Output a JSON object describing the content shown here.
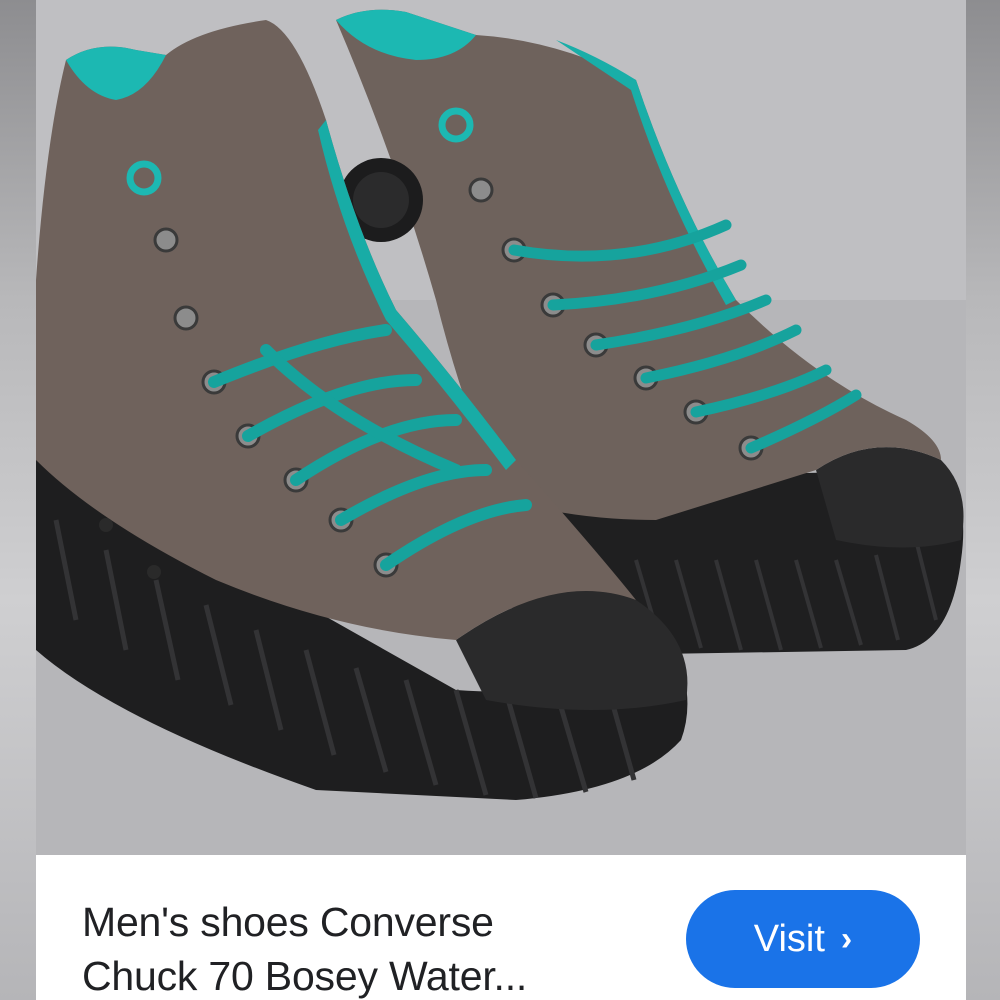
{
  "product": {
    "title_line1": "Men's shoes Converse",
    "title_line2": "Chuck 70 Bosey Water..."
  },
  "actions": {
    "visit_label": "Visit",
    "visit_icon": "chevron-right-icon"
  },
  "colors": {
    "button_bg": "#1a73e8",
    "title_text": "#202124",
    "shoe_suede": "#6f625c",
    "accent_teal": "#17b3ad",
    "sole_black": "#1e1e1e"
  },
  "image": {
    "subject": "Converse Chuck 70 Bosey high-top sneakers"
  }
}
